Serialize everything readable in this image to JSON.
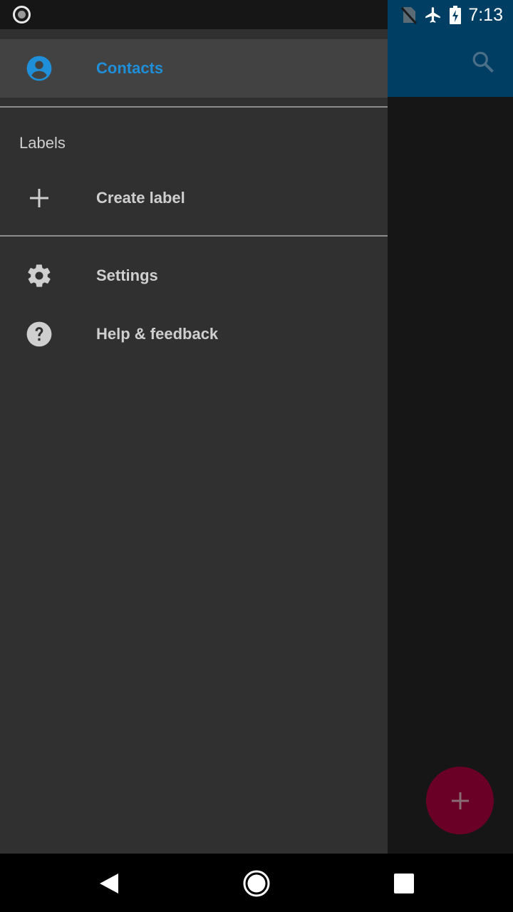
{
  "status_bar": {
    "time": "7:13",
    "icons": [
      "no-sim-icon",
      "airplane-mode-icon",
      "battery-charging-icon"
    ],
    "notification_icon": "record-icon"
  },
  "app_bar": {
    "search_icon": "search-icon",
    "background_color": "#003e63"
  },
  "drawer": {
    "primary_item": {
      "label": "Contacts",
      "icon": "account-circle-icon",
      "active_color": "#1e8fd8"
    },
    "labels_section": {
      "header": "Labels",
      "create_label": "Create label"
    },
    "footer_items": [
      {
        "label": "Settings",
        "icon": "gear-icon"
      },
      {
        "label": "Help & feedback",
        "icon": "help-icon"
      }
    ]
  },
  "fab": {
    "icon": "add-icon",
    "color": "#6b0026"
  },
  "nav_bar": {
    "buttons": [
      "back-icon",
      "home-icon",
      "recents-icon"
    ]
  }
}
